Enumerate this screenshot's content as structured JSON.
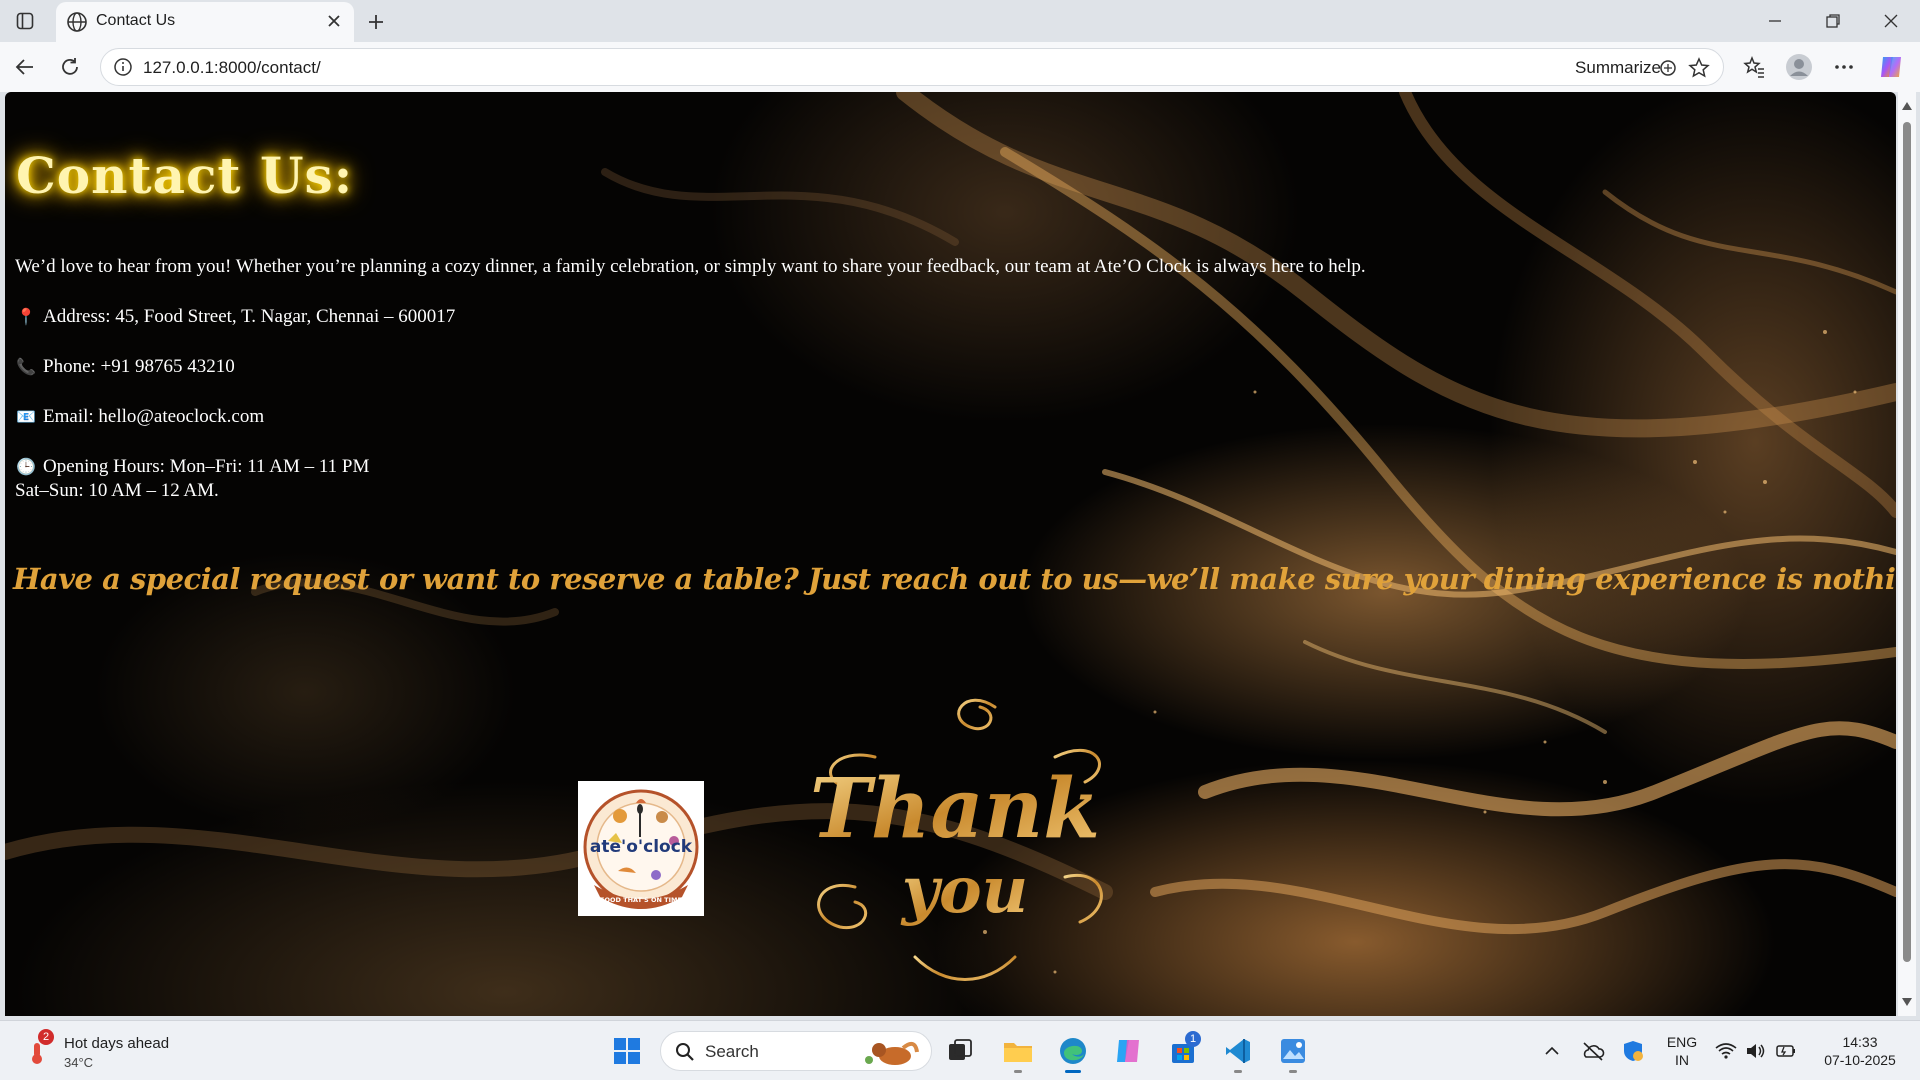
{
  "browser": {
    "tab_title": "Contact Us",
    "url": "127.0.0.1:8000/contact/",
    "summarize_label": "Summarize"
  },
  "page": {
    "heading": "Contact Us:",
    "intro": "We’d love to hear from you! Whether you’re planning a cozy dinner, a family celebration, or simply want to share your feedback, our team at Ate’O Clock is always here to help.",
    "address_icon": "📍",
    "address": "Address: 45, Food Street, T. Nagar, Chennai – 600017",
    "phone_icon": "📞",
    "phone": "Phone: +91 98765 43210",
    "email_icon": "📧",
    "email": "Email: hello@ateoclock.com",
    "hours_icon": "🕒",
    "hours_line1": "Opening Hours: Mon–Fri: 11 AM – 11 PM",
    "hours_line2": "Sat–Sun: 10 AM – 12 AM.",
    "tagline": "Have a special request or want to reserve a table? Just reach out to us—we’ll make sure your dining experience is nothing short of delightful.",
    "logo_name": "ate'o'clock",
    "logo_subtitle": "FOOD THAT'S ON TIME",
    "thankyou_line1": "Thank",
    "thankyou_line2": "you"
  },
  "taskbar": {
    "weather_badge": "2",
    "weather_title": "Hot days ahead",
    "weather_temp": "34°C",
    "search_label": "Search",
    "store_badge": "1",
    "lang_line1": "ENG",
    "lang_line2": "IN",
    "time": "14:33",
    "date": "07-10-2025"
  },
  "colors": {
    "heading_glow": "#ffd700",
    "tagline": "#e0a23a",
    "page_background": "#050403",
    "accent_blue": "#0067c0"
  }
}
